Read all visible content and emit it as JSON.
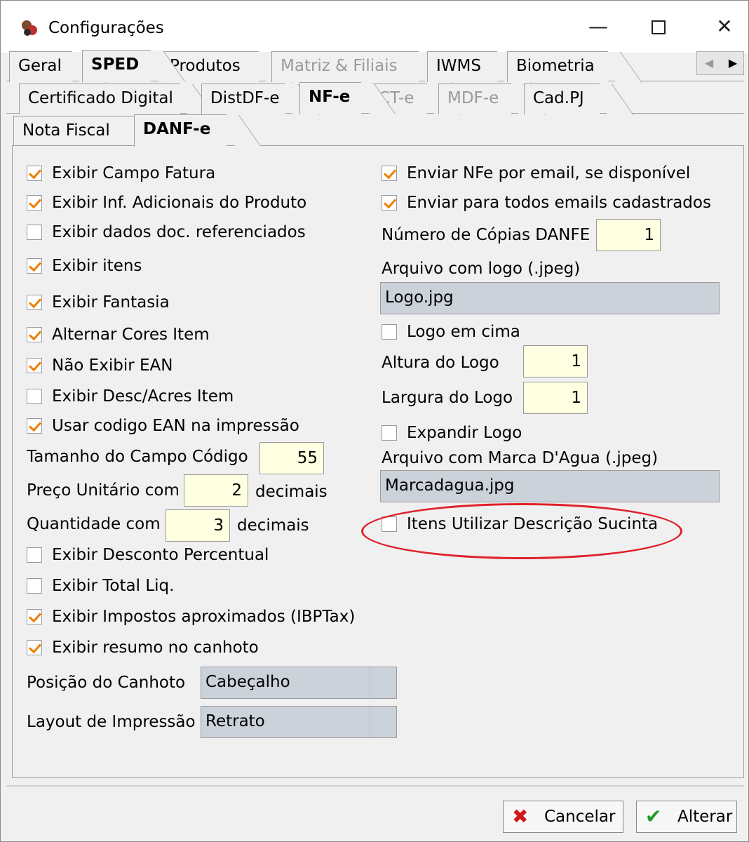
{
  "window": {
    "title": "Configurações",
    "controls": {
      "minimize": "—",
      "close": "✕"
    }
  },
  "tabs_row1": [
    {
      "label": "Geral"
    },
    {
      "label": "SPED",
      "active": true
    },
    {
      "label": "Produtos"
    },
    {
      "label": "Matriz & Filiais",
      "disabled": true
    },
    {
      "label": "IWMS"
    },
    {
      "label": "Biometria"
    }
  ],
  "tab_scroll": {
    "left": "◀",
    "right": "▶"
  },
  "tabs_row2": [
    {
      "label": "Certificado Digital"
    },
    {
      "label": "DistDF-e"
    },
    {
      "label": "NF-e",
      "active": true
    },
    {
      "label": "CT-e",
      "disabled": true
    },
    {
      "label": "MDF-e",
      "disabled": true
    },
    {
      "label": "Cad.PJ"
    }
  ],
  "tabs_row3": [
    {
      "label": "Nota Fiscal"
    },
    {
      "label": "DANF-e",
      "active": true
    }
  ],
  "left": {
    "exibir_campo_fatura": {
      "label": "Exibir Campo Fatura",
      "checked": true
    },
    "exibir_inf_adicionais": {
      "label": "Exibir Inf. Adicionais do Produto",
      "checked": true
    },
    "exibir_dados_doc": {
      "label": "Exibir dados doc. referenciados",
      "checked": false
    },
    "exibir_itens": {
      "label": "Exibir itens",
      "checked": true
    },
    "exibir_fantasia": {
      "label": "Exibir Fantasia",
      "checked": true
    },
    "alternar_cores": {
      "label": "Alternar Cores Item",
      "checked": true
    },
    "nao_exibir_ean": {
      "label": "Não Exibir EAN",
      "checked": true
    },
    "exibir_desc_acres": {
      "label": "Exibir Desc/Acres Item",
      "checked": false
    },
    "usar_codigo_ean": {
      "label": "Usar codigo EAN na impressão",
      "checked": true
    },
    "tamanho_campo_codigo": {
      "label": "Tamanho do Campo Código",
      "value": "55"
    },
    "preco_unitario": {
      "label": "Preço Unitário com",
      "value": "2",
      "suffix": "decimais"
    },
    "quantidade": {
      "label": "Quantidade com",
      "value": "3",
      "suffix": "decimais"
    },
    "exibir_desconto_percentual": {
      "label": "Exibir Desconto Percentual",
      "checked": false
    },
    "exibir_total_liq": {
      "label": "Exibir Total Liq.",
      "checked": false
    },
    "exibir_impostos": {
      "label": "Exibir Impostos aproximados (IBPTax)",
      "checked": true
    },
    "exibir_resumo_canhoto": {
      "label": "Exibir resumo no canhoto",
      "checked": true
    },
    "posicao_canhoto": {
      "label": "Posição do Canhoto",
      "value": "Cabeçalho"
    },
    "layout_impressao": {
      "label": "Layout de Impressão",
      "value": "Retrato"
    }
  },
  "right": {
    "enviar_email": {
      "label": "Enviar NFe por email, se disponível",
      "checked": true
    },
    "enviar_todos": {
      "label": "Enviar para todos emails cadastrados",
      "checked": true
    },
    "numero_copias": {
      "label": "Número de Cópias DANFE",
      "value": "1"
    },
    "arquivo_logo": {
      "label": "Arquivo com logo (.jpeg)",
      "value": "Logo.jpg"
    },
    "logo_em_cima": {
      "label": "Logo em cima",
      "checked": false
    },
    "altura_logo": {
      "label": "Altura do Logo",
      "value": "1"
    },
    "largura_logo": {
      "label": "Largura do Logo",
      "value": "1"
    },
    "expandir_logo": {
      "label": "Expandir Logo",
      "checked": false
    },
    "arquivo_marca": {
      "label": "Arquivo com Marca D'Agua (.jpeg)",
      "value": "Marcadagua.jpg"
    },
    "itens_descricao_sucinta": {
      "label": "Itens Utilizar Descrição Sucinta",
      "checked": false
    }
  },
  "buttons": {
    "cancelar": {
      "label": "Cancelar",
      "icon": "✖"
    },
    "alterar": {
      "label": "Alterar",
      "icon": "✔"
    }
  },
  "colors": {
    "check": "#f07d00",
    "highlight": "#e0202a",
    "input_yellow": "#ffffe1",
    "input_gray": "#ccd2d9"
  }
}
